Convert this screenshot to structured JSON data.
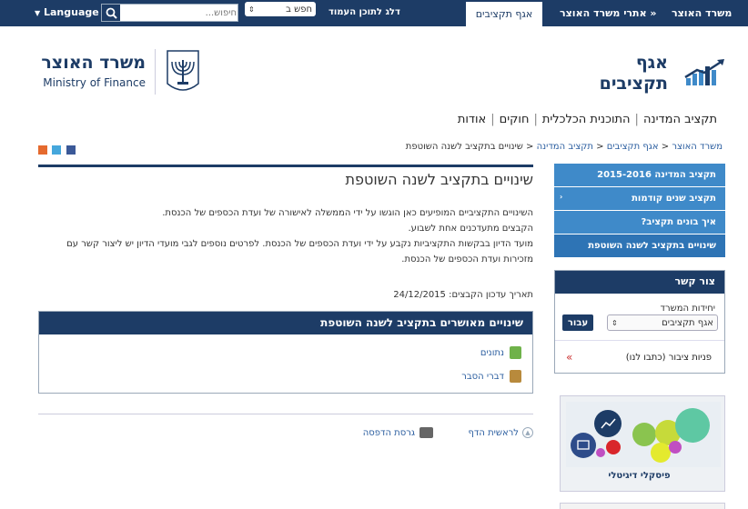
{
  "topbar": {
    "active_tab": "אגף תקציבים",
    "links": [
      "משרד האוצר",
      "אתרי משרד האוצר »"
    ],
    "skip_link": "דלג לתוכן העמוד",
    "search_scope": "חפש ב",
    "search_placeholder": "חיפוש...",
    "language": "Language"
  },
  "brand": {
    "line1": "אגף",
    "line2": "תקציבים",
    "mof_he": "משרד האוצר",
    "mof_en": "Ministry of Finance"
  },
  "nav": [
    "תקציב המדינה",
    "התוכנית הכלכלית",
    "חוקים",
    "אודות"
  ],
  "breadcrumb": [
    "משרד האוצר",
    "אגף תקציבים",
    "תקציב המדינה",
    "שינויים בתקציב לשנה השוטפת"
  ],
  "page": {
    "title": "שינויים בתקציב לשנה השוטפת",
    "paragraphs": [
      "השינויים התקציביים המופיעים כאן הוגשו על ידי הממשלה לאישורה של ועדת הכספים של הכנסת.",
      "הקבצים מתעדכנים אחת לשבוע.",
      "מועד הדיון בבקשות התקציביות נקבע על ידי ועדת הכספים של הכנסת. לפרטים נוספים לגבי מועדי הדיון יש ליצור קשר עם",
      "מזכירות ועדת הכספים של הכנסת."
    ],
    "update_label": "תאריך עדכון הקבצים:",
    "update_date": "24/12/2015"
  },
  "approved_box": {
    "title": "שינויים מאושרים בתקציב לשנה השוטפת",
    "files": [
      "נתונים",
      "דברי הסבר"
    ]
  },
  "footer_links": {
    "top": "לראשית הדף",
    "print": "גרסת הדפסה"
  },
  "sidemenu": [
    "תקציב המדינה 2015-2016",
    "תקציב שנים קודמות",
    "איך בונים תקציב?",
    "שינויים בתקציב לשנה השוטפת"
  ],
  "contact": {
    "title": "צור קשר",
    "unit_label": "יחידות המשרד",
    "unit_value": "אגף תקציבים",
    "go_button": "עבור",
    "public_link": "פניות ציבור (כתבו לנו)"
  },
  "promo": {
    "caption": "פיסקלי דיגיטלי"
  },
  "colors": {
    "navy": "#1d3c66",
    "menu_blue": "#3f8ac9",
    "link": "#2a5d9f"
  }
}
